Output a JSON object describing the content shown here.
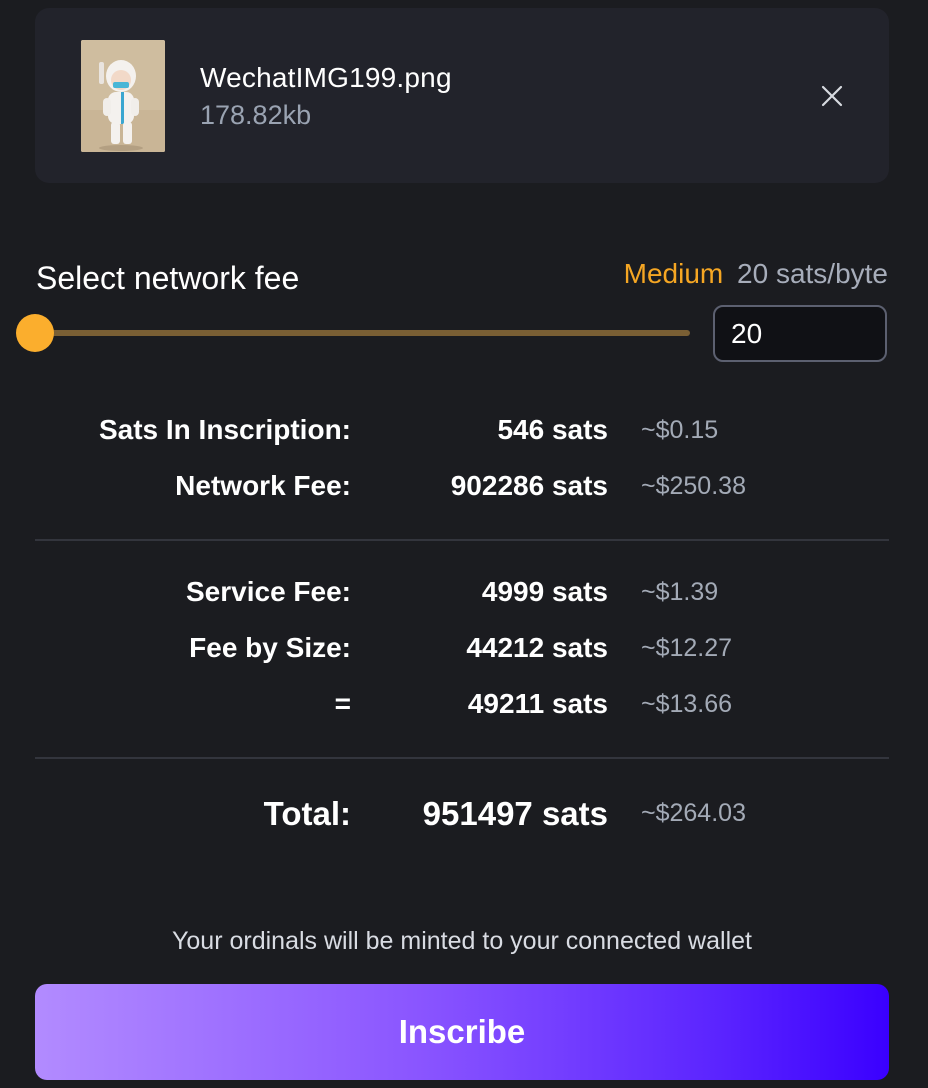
{
  "file": {
    "name": "WechatIMG199.png",
    "size": "178.82kb"
  },
  "fee": {
    "title": "Select network fee",
    "level": "Medium",
    "rate": "20 sats/byte",
    "slider_fraction": 0.0,
    "input_value": "20"
  },
  "summary": {
    "rows": [
      {
        "label": "Sats In Inscription:",
        "amount": "546 sats",
        "usd": "~$0.15"
      },
      {
        "label": "Network Fee:",
        "amount": "902286 sats",
        "usd": "~$250.38"
      },
      {
        "label": "Service Fee:",
        "amount": "4999 sats",
        "usd": "~$1.39"
      },
      {
        "label": "Fee by Size:",
        "amount": "44212 sats",
        "usd": "~$12.27"
      },
      {
        "label": "=",
        "amount": "49211 sats",
        "usd": "~$13.66"
      }
    ],
    "total": {
      "label": "Total:",
      "amount": "951497 sats",
      "usd": "~$264.03"
    }
  },
  "note": "Your ordinals will be minted to your connected wallet",
  "action": {
    "inscribe_label": "Inscribe"
  },
  "colors": {
    "background": "#1b1c20",
    "card": "#22232b",
    "accent_orange": "#f5a623",
    "button_gradient_start": "#b28bff",
    "button_gradient_end": "#3a00ff"
  },
  "icons": {
    "close": "close-icon",
    "thumbnail": "image-thumbnail"
  }
}
